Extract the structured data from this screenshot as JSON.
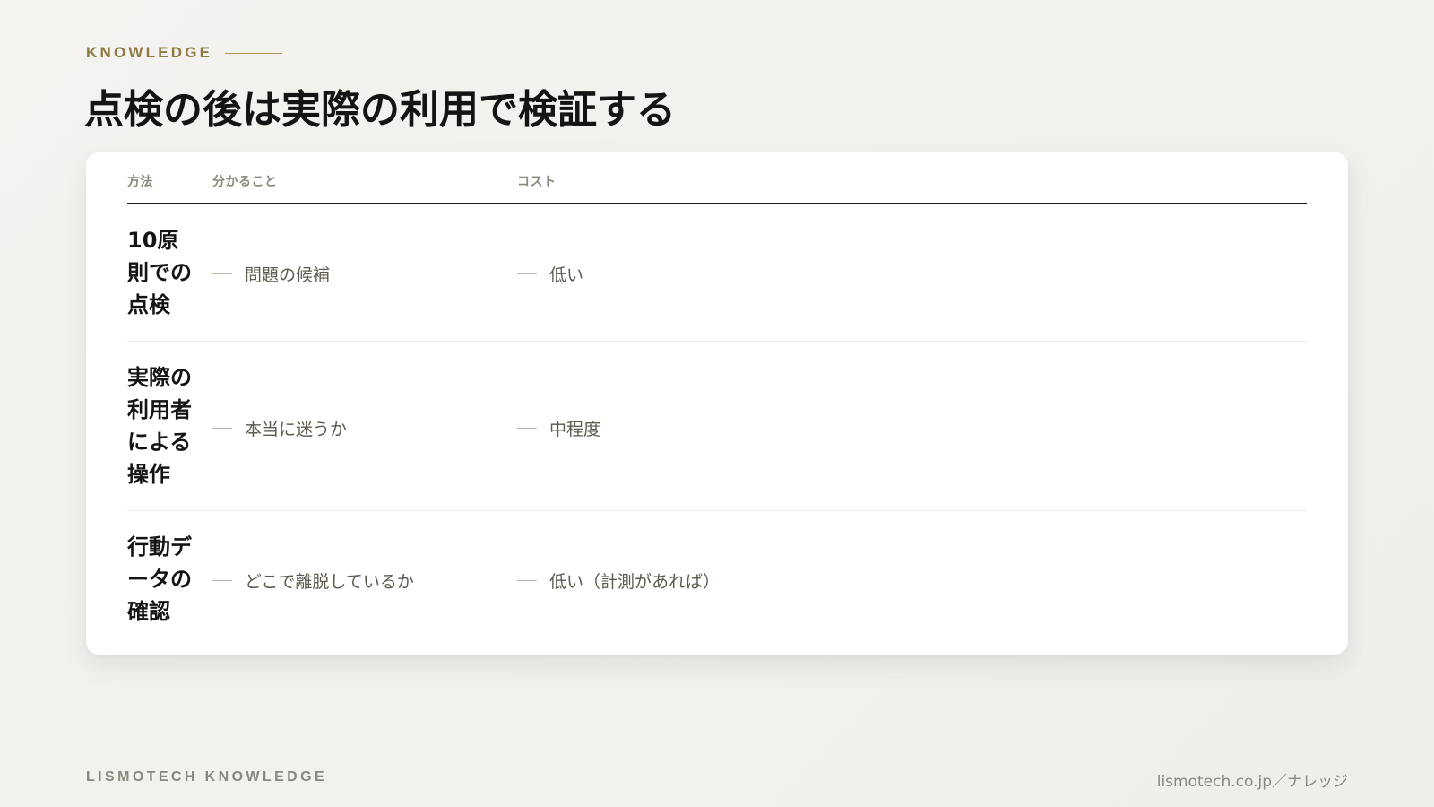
{
  "header": {
    "eyebrow": "KNOWLEDGE",
    "title": "点検の後は実際の利用で検証する"
  },
  "table": {
    "columns": [
      "方法",
      "分かること",
      "コスト"
    ],
    "rows": [
      {
        "method": "10原則での点検",
        "finding": "問題の候補",
        "cost": "低い"
      },
      {
        "method": "実際の利用者による操作",
        "finding": "本当に迷うか",
        "cost": "中程度"
      },
      {
        "method": "行動データの確認",
        "finding": "どこで離脱しているか",
        "cost": "低い（計測があれば）"
      }
    ]
  },
  "footer": {
    "brand": "LISMOTECH KNOWLEDGE",
    "url": "lismotech.co.jp／ナレッジ"
  },
  "colors": {
    "accent": "#8c7a3f",
    "text": "#141414",
    "muted": "#8a877f"
  }
}
